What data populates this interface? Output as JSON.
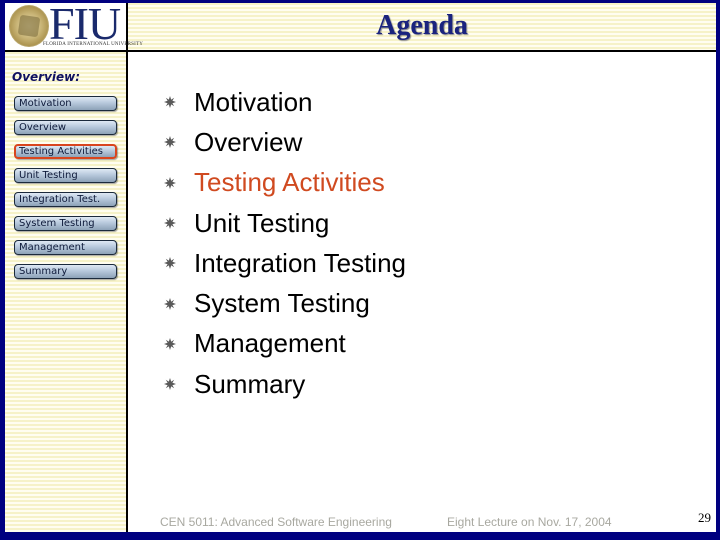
{
  "logo": {
    "wordmark": "FIU",
    "subtitle": "FLORIDA INTERNATIONAL UNIVERSITY"
  },
  "header": {
    "title": "Agenda"
  },
  "sidebar": {
    "heading": "Overview:",
    "items": [
      {
        "label": "Motivation",
        "active": false
      },
      {
        "label": "Overview",
        "active": false
      },
      {
        "label": "Testing Activities",
        "active": true
      },
      {
        "label": "Unit Testing",
        "active": false
      },
      {
        "label": "Integration Test.",
        "active": false
      },
      {
        "label": "System Testing",
        "active": false
      },
      {
        "label": "Management",
        "active": false
      },
      {
        "label": "Summary",
        "active": false
      }
    ]
  },
  "main": {
    "bullet_icon": "starburst-bullet-icon",
    "items": [
      {
        "text": "Motivation",
        "highlight": false
      },
      {
        "text": "Overview",
        "highlight": false
      },
      {
        "text": "Testing Activities",
        "highlight": true
      },
      {
        "text": "Unit Testing",
        "highlight": false
      },
      {
        "text": "Integration Testing",
        "highlight": false
      },
      {
        "text": "System Testing",
        "highlight": false
      },
      {
        "text": "Management",
        "highlight": false
      },
      {
        "text": "Summary",
        "highlight": false
      }
    ]
  },
  "footer": {
    "course": "CEN 5011: Advanced Software Engineering",
    "lecture": "Eight Lecture on Nov. 17, 2004",
    "page_number": "29"
  },
  "colors": {
    "frame": "#000080",
    "title": "#1a237e",
    "highlight": "#d04a20",
    "active_border": "#d9451e",
    "footer_text": "#a8a8a0"
  }
}
